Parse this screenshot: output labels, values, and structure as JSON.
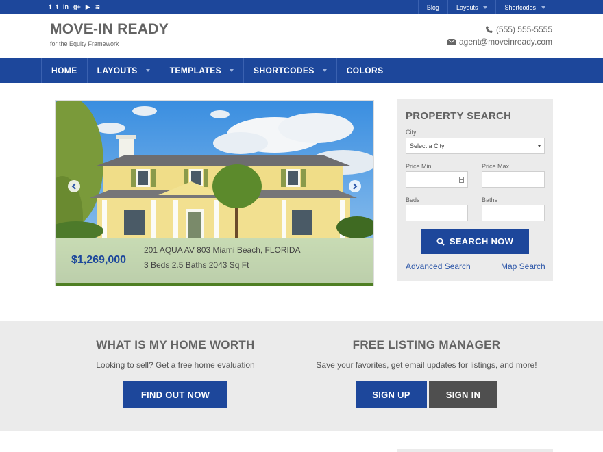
{
  "topbar": {
    "social_icons": [
      "facebook-icon",
      "twitter-icon",
      "linkedin-icon",
      "google-plus-icon",
      "youtube-icon",
      "rss-icon"
    ],
    "social_glyphs": [
      "f",
      "t",
      "in",
      "g+",
      "▶",
      "≋"
    ],
    "links": [
      {
        "label": "Blog",
        "has_dropdown": false
      },
      {
        "label": "Layouts",
        "has_dropdown": true
      },
      {
        "label": "Shortcodes",
        "has_dropdown": true
      }
    ]
  },
  "header": {
    "title": "MOVE-IN READY",
    "tagline": "for the Equity Framework",
    "phone": "(555) 555-5555",
    "email": "agent@moveinready.com"
  },
  "nav": {
    "items": [
      {
        "label": "HOME",
        "has_dropdown": false
      },
      {
        "label": "LAYOUTS",
        "has_dropdown": true
      },
      {
        "label": "TEMPLATES",
        "has_dropdown": true
      },
      {
        "label": "SHORTCODES",
        "has_dropdown": true
      },
      {
        "label": "COLORS",
        "has_dropdown": false
      }
    ]
  },
  "listing": {
    "price": "$1,269,000",
    "address": "201 AQUA AV 803 Miami Beach, FLORIDA",
    "details": "3 Beds 2.5 Baths 2043 Sq Ft"
  },
  "property_search": {
    "title": "PROPERTY SEARCH",
    "city_label": "City",
    "city_value": "Select a City",
    "price_min_label": "Price Min",
    "price_max_label": "Price Max",
    "beds_label": "Beds",
    "baths_label": "Baths",
    "button_label": "SEARCH NOW",
    "advanced_link": "Advanced Search",
    "map_link": "Map Search"
  },
  "home_worth": {
    "title": "WHAT IS MY HOME WORTH",
    "text": "Looking to sell? Get a free home evaluation",
    "button": "FIND OUT NOW"
  },
  "listing_manager": {
    "title": "FREE LISTING MANAGER",
    "text": "Save your favorites, get email updates for listings, and more!",
    "sign_up": "SIGN UP",
    "sign_in": "SIGN IN"
  },
  "colors": {
    "brand_blue": "#1d479b",
    "dark_gray_button": "#4f4f4f",
    "band_gray": "#ebebeb"
  }
}
